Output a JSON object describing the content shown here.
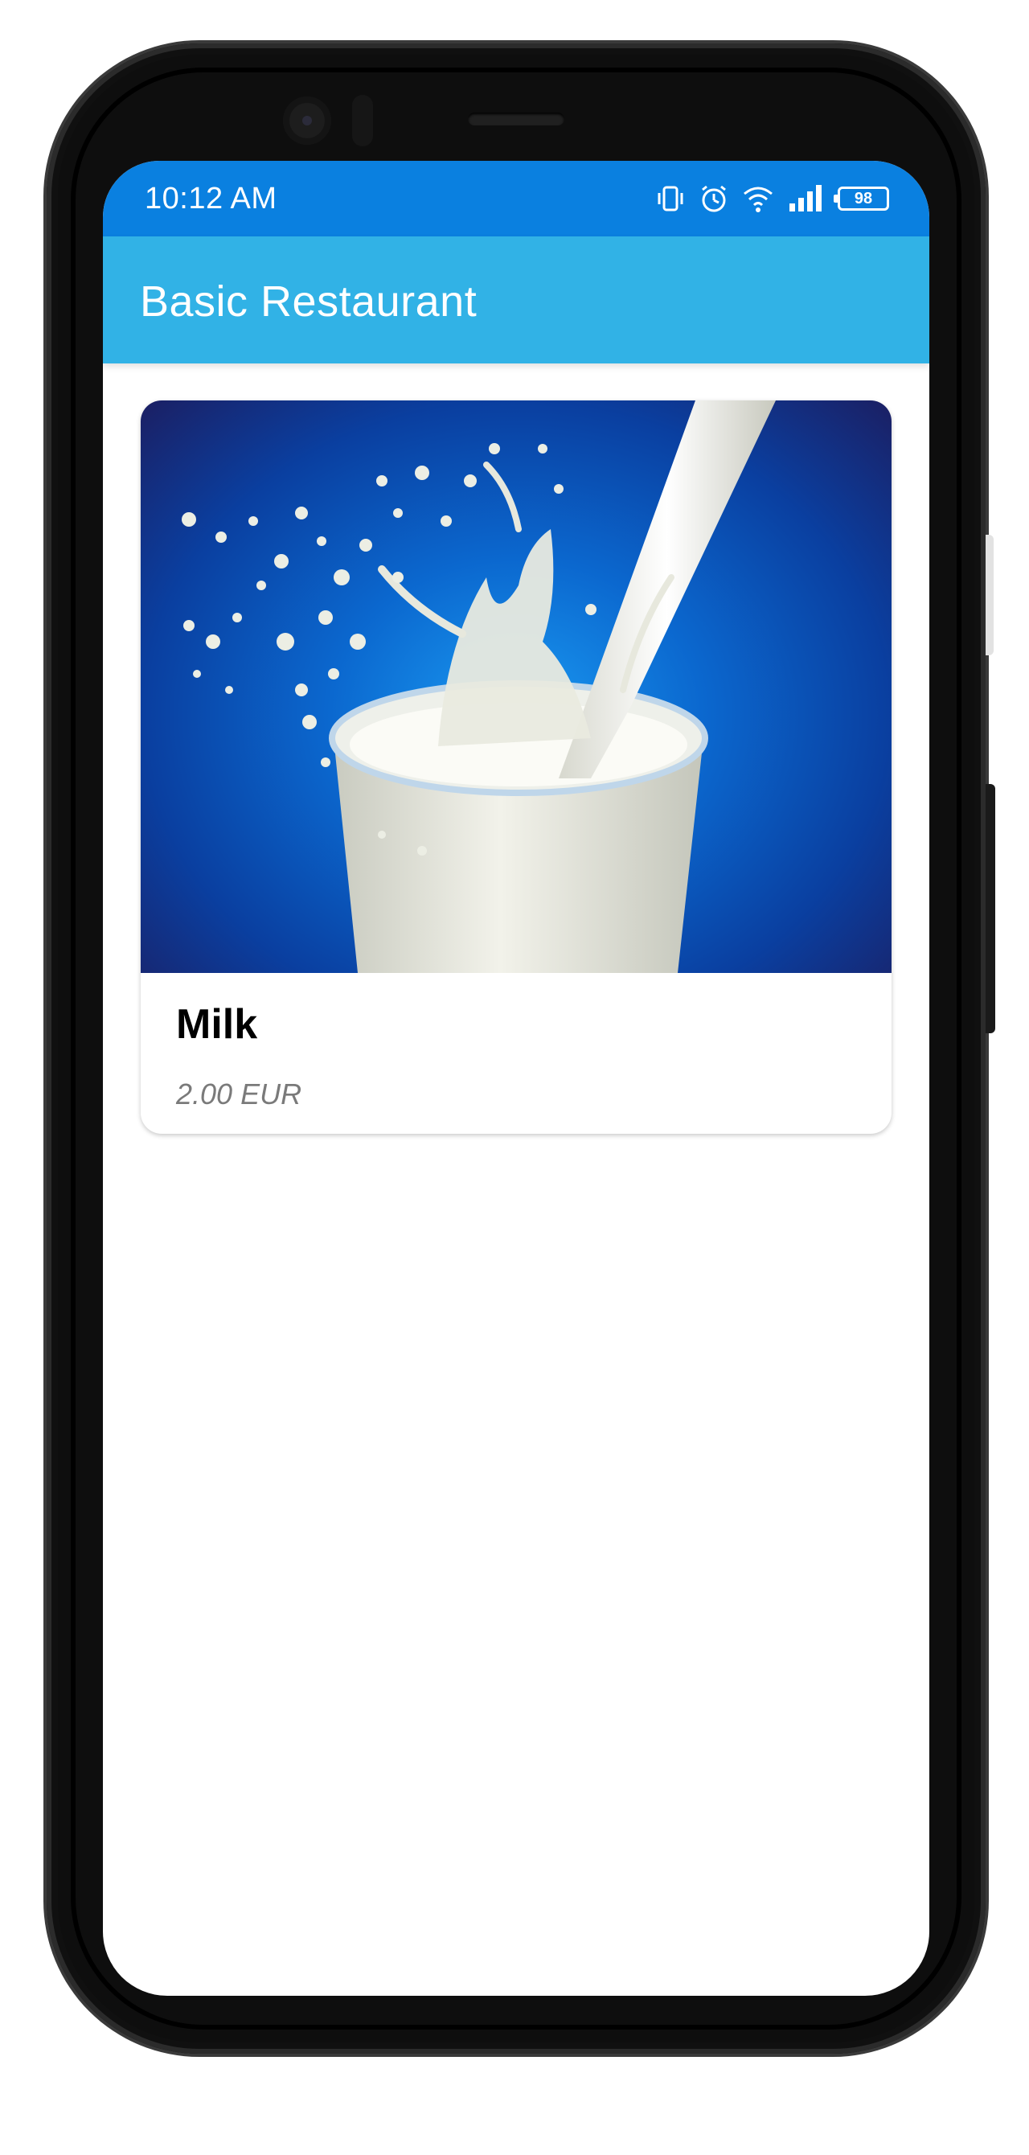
{
  "status_bar": {
    "time": "10:12 AM",
    "battery_level": "98",
    "icons": [
      "vibrate-icon",
      "alarm-icon",
      "wifi-icon",
      "signal-icon",
      "battery-icon"
    ]
  },
  "app_bar": {
    "title": "Basic Restaurant"
  },
  "menu": {
    "items": [
      {
        "name": "Milk",
        "price": "2.00 EUR",
        "image": "glass-of-milk-splash"
      }
    ]
  },
  "colors": {
    "status_bar": "#0a80e0",
    "app_bar": "#31b2e6",
    "price_text": "#7a7a7a"
  }
}
